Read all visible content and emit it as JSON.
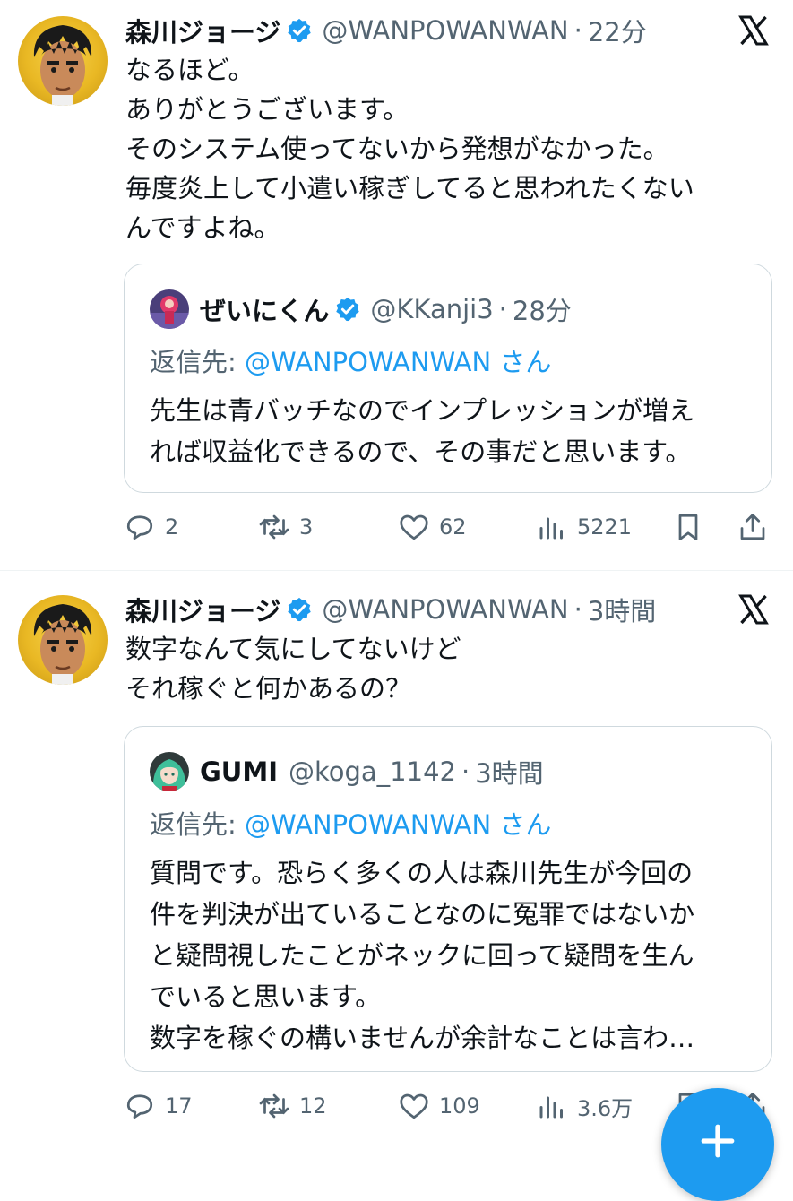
{
  "tweets": [
    {
      "author_name": "森川ジョージ",
      "handle": "@WANPOWANWAN",
      "time": "22分",
      "text": "なるほど。\nありがとうございます。\nそのシステム使ってないから発想がなかった。\n毎度炎上して小遣い稼ぎしてると思われたくない\nんですよね。",
      "quote": {
        "author_name": "ぜいにくん",
        "handle": "@KKanji3",
        "time": "28分",
        "reply_prefix": "返信先: ",
        "reply_to": "@WANPOWANWAN",
        "reply_suffix": "さん",
        "text": "先生は青バッチなのでインプレッションが増え\nれば収益化できるので、その事だと思います。"
      },
      "stats": {
        "replies": "2",
        "retweets": "3",
        "likes": "62",
        "views": "5221"
      }
    },
    {
      "author_name": "森川ジョージ",
      "handle": "@WANPOWANWAN",
      "time": "3時間",
      "text": "数字なんて気にしてないけど\nそれ稼ぐと何かあるの？",
      "quote": {
        "author_name": "GUMI",
        "handle": "@koga_1142",
        "time": "3時間",
        "reply_prefix": "返信先: ",
        "reply_to": "@WANPOWANWAN",
        "reply_suffix": "さん",
        "text": "質問です。恐らく多くの人は森川先生が今回の\n件を判決が出ていることなのに冤罪ではないか\nと疑問視したことがネックに回って疑問を生ん\nでいると思います。\n数字を稼ぐの構いませんが余計なことは言わ…"
      },
      "stats": {
        "replies": "17",
        "retweets": "12",
        "likes": "109",
        "views": "3.6万"
      }
    }
  ],
  "separator": "·",
  "colors": {
    "accent": "#1d9bf0",
    "secondary_text": "#536471",
    "border": "#cfd9de"
  },
  "icons": [
    "verified-badge-icon",
    "x-logo-icon",
    "reply-icon",
    "retweet-icon",
    "like-icon",
    "views-icon",
    "bookmark-icon",
    "share-icon",
    "compose-icon"
  ]
}
